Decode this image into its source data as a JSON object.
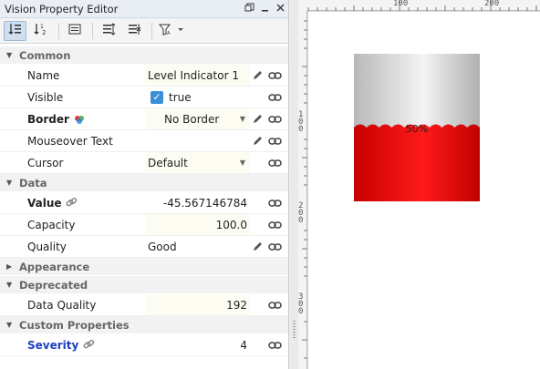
{
  "panel": {
    "title": "Vision Property Editor",
    "title_buttons": [
      "restore-icon",
      "minimize-icon",
      "close-icon"
    ]
  },
  "toolbar": {
    "tools": [
      "sort-categorized-icon",
      "sort-alphabetical-icon",
      "details-icon",
      "expand-all-icon",
      "collapse-all-icon",
      "filter-icon"
    ]
  },
  "categories": {
    "common": "Common",
    "data": "Data",
    "appearance": "Appearance",
    "deprecated": "Deprecated",
    "custom": "Custom Properties"
  },
  "props": {
    "name": {
      "label": "Name",
      "value": "Level Indicator 1"
    },
    "visible": {
      "label": "Visible",
      "value": "true",
      "checked": true
    },
    "border": {
      "label": "Border",
      "value": "No Border"
    },
    "mouseover": {
      "label": "Mouseover Text",
      "value": ""
    },
    "cursor": {
      "label": "Cursor",
      "value": "Default"
    },
    "value": {
      "label": "Value",
      "value": "-45.567146784"
    },
    "capacity": {
      "label": "Capacity",
      "value": "100.0"
    },
    "quality": {
      "label": "Quality",
      "value": "Good"
    },
    "data_quality": {
      "label": "Data Quality",
      "value": "192"
    },
    "severity": {
      "label": "Severity",
      "value": "4"
    }
  },
  "ruler": {
    "h_labels": [
      "100",
      "200"
    ],
    "v_labels": [
      "1\n0\n0",
      "2\n0\n0",
      "3\n0\n0"
    ]
  },
  "level_indicator": {
    "label": "50%",
    "fill_fraction": 0.5,
    "fill_color": "#e00000",
    "empty_color": "#d0d0d0"
  }
}
